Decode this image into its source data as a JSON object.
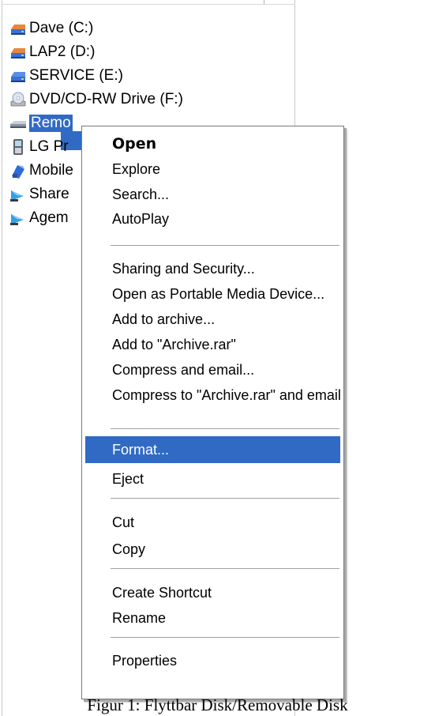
{
  "drives": [
    {
      "label": "Dave (C:)",
      "icon": "hard-drive-icon"
    },
    {
      "label": "LAP2 (D:)",
      "icon": "hard-drive-icon"
    },
    {
      "label": "SERVICE (E:)",
      "icon": "hard-drive-icon"
    },
    {
      "label": "DVD/CD-RW Drive (F:)",
      "icon": "cd-drive-icon"
    },
    {
      "label": "Remo",
      "icon": "removable-disk-icon"
    },
    {
      "label": "LG Pr",
      "icon": "phone-icon"
    },
    {
      "label": "Mobile",
      "icon": "mobile-device-icon"
    },
    {
      "label": "Share",
      "icon": "shared-folder-icon"
    },
    {
      "label": "Agem",
      "icon": "shared-folder-icon"
    }
  ],
  "context_menu": {
    "items": [
      {
        "label": "Open",
        "bold": true
      },
      {
        "label": "Explore"
      },
      {
        "label": "Search..."
      },
      {
        "label": "AutoPlay"
      },
      {
        "label": "Sharing and Security..."
      },
      {
        "label": "Open as Portable Media Device..."
      },
      {
        "label": "Add to archive..."
      },
      {
        "label": "Add to \"Archive.rar\""
      },
      {
        "label": "Compress and email..."
      },
      {
        "label": "Compress to \"Archive.rar\" and email"
      },
      {
        "label": "Format...",
        "active": true
      },
      {
        "label": "Eject"
      },
      {
        "label": "Cut"
      },
      {
        "label": "Copy"
      },
      {
        "label": "Create Shortcut"
      },
      {
        "label": "Rename"
      },
      {
        "label": "Properties"
      }
    ]
  },
  "caption": "Figur 1: Flyttbar Disk/Removable Disk",
  "colors": {
    "selection": "#316ac5",
    "drive_blue": "#3a6fd8",
    "drive_orange": "#e8863a"
  }
}
